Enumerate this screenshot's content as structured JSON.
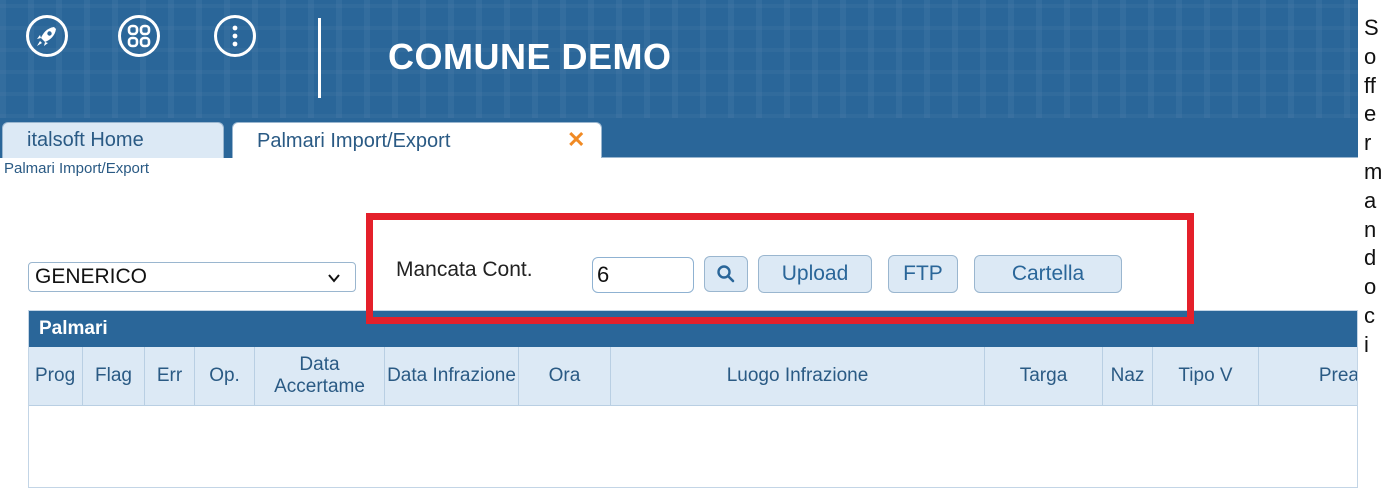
{
  "header": {
    "title": "COMUNE DEMO",
    "icons": [
      "rocket-icon",
      "apps-grid-icon",
      "more-vertical-icon"
    ]
  },
  "tabs": [
    {
      "label": "italsoft Home",
      "active": false
    },
    {
      "label": "Palmari Import/Export",
      "active": true,
      "close": "✕"
    }
  ],
  "breadcrumb": "Palmari Import/Export",
  "filters": {
    "select_value": "GENERICO",
    "mancata_label": "Mancata Cont.",
    "mancata_value": "6",
    "upload": "Upload",
    "ftp": "FTP",
    "cartella": "Cartella"
  },
  "grid": {
    "title": "Palmari",
    "columns": [
      "Prog",
      "Flag",
      "Err",
      "Op.",
      "Data Accertame",
      "Data Infrazione",
      "Ora",
      "Luogo Infrazione",
      "Targa",
      "Naz",
      "Tipo V",
      "Prea"
    ]
  },
  "side_text": [
    "S",
    "o",
    "ff",
    "e",
    "r",
    "m",
    "a",
    "n",
    "d",
    "o",
    "c",
    "i"
  ],
  "colors": {
    "header_bg": "#2a6699",
    "accent_close": "#f08a24",
    "highlight": "#e4202a"
  }
}
